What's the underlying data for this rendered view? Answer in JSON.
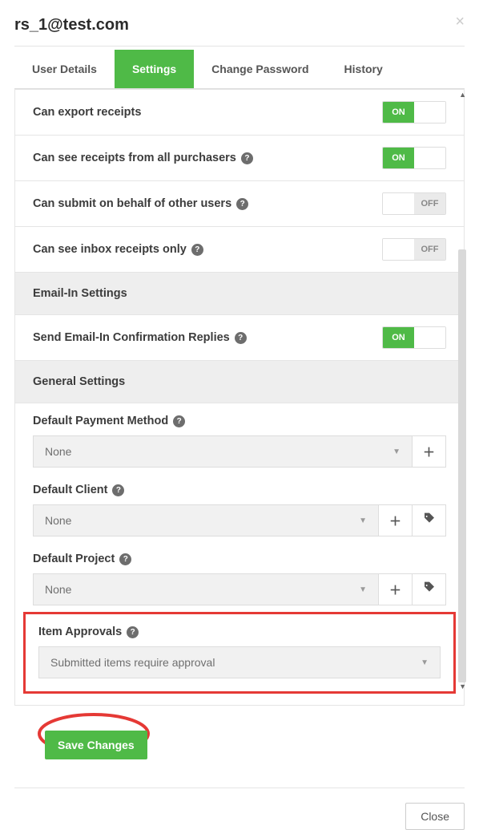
{
  "header": {
    "title": "rs_1@test.com"
  },
  "tabs": {
    "user_details": "User Details",
    "settings": "Settings",
    "change_password": "Change Password",
    "history": "History"
  },
  "settings": {
    "can_export_receipts": {
      "label": "Can export receipts",
      "state": "ON"
    },
    "can_see_all_purchasers": {
      "label": "Can see receipts from all purchasers",
      "state": "ON"
    },
    "can_submit_behalf": {
      "label": "Can submit on behalf of other users",
      "state": "OFF"
    },
    "can_see_inbox_only": {
      "label": "Can see inbox receipts only",
      "state": "OFF"
    }
  },
  "email_in": {
    "header": "Email-In Settings",
    "send_confirmation": {
      "label": "Send Email-In Confirmation Replies",
      "state": "ON"
    }
  },
  "general": {
    "header": "General Settings",
    "default_payment_method": {
      "label": "Default Payment Method",
      "value": "None"
    },
    "default_client": {
      "label": "Default Client",
      "value": "None"
    },
    "default_project": {
      "label": "Default Project",
      "value": "None"
    },
    "item_approvals": {
      "label": "Item Approvals",
      "value": "Submitted items require approval"
    }
  },
  "buttons": {
    "save": "Save Changes",
    "close": "Close"
  }
}
